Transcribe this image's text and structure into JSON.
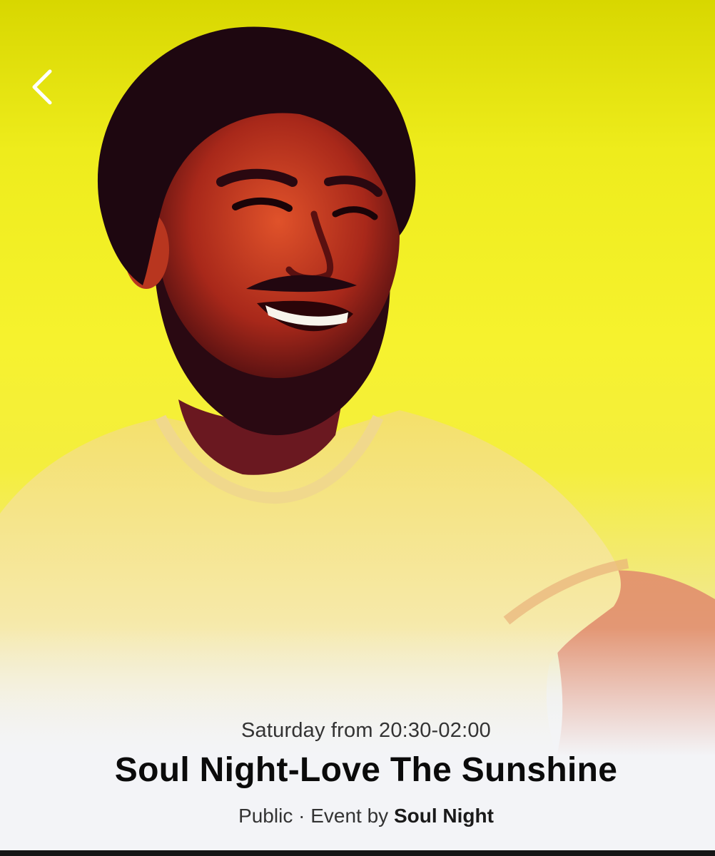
{
  "cover": {
    "icon": "back-chevron-icon",
    "colors": {
      "background_top": "#d8d700",
      "background_mid": "#f6f22e",
      "fade": "#f3f4f7"
    }
  },
  "event": {
    "time": "Saturday from 20:30-02:00",
    "title": "Soul Night-Love The Sunshine",
    "privacy": "Public",
    "separator": "·",
    "event_by": "Event by",
    "host": "Soul Night"
  }
}
